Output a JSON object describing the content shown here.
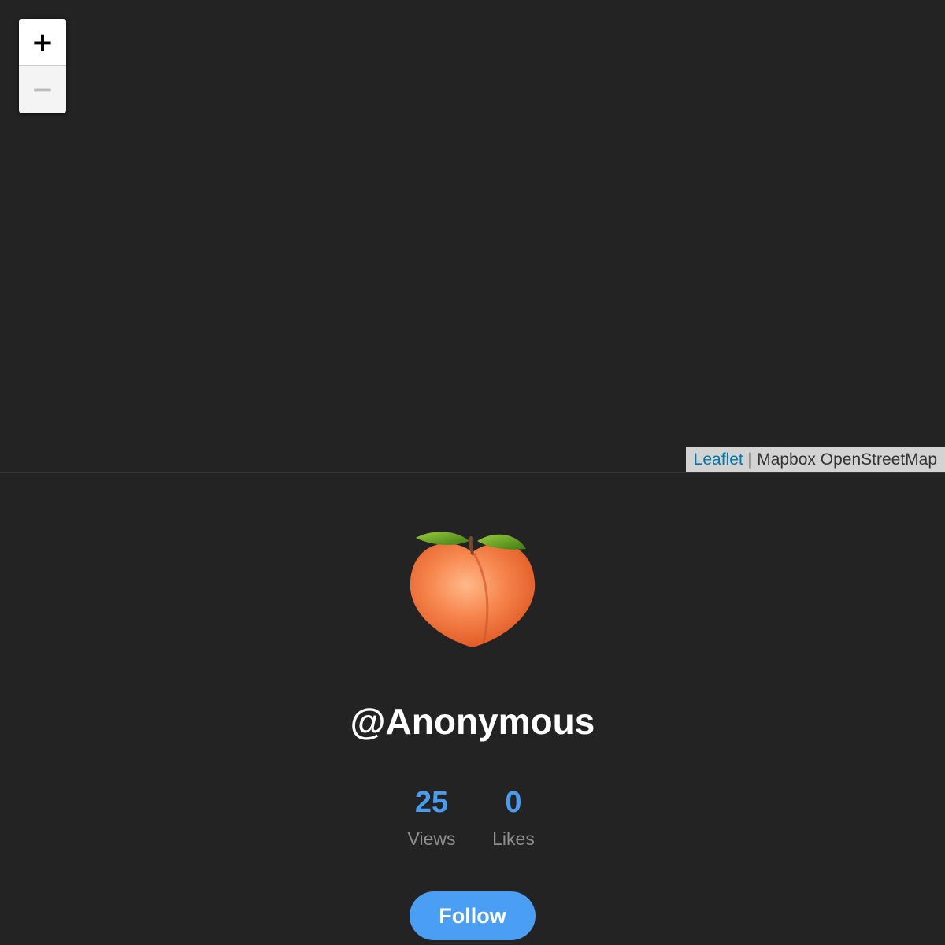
{
  "map": {
    "zoom_in_label": "+",
    "zoom_out_label": "−",
    "attribution": {
      "leaflet_link": "Leaflet",
      "separator": "|",
      "providers": "Mapbox OpenStreetMap"
    }
  },
  "profile": {
    "avatar_icon": "peach-emoji",
    "username": "@Anonymous",
    "stats": [
      {
        "value": "25",
        "label": "Views"
      },
      {
        "value": "0",
        "label": "Likes"
      }
    ],
    "follow_label": "Follow"
  },
  "colors": {
    "background": "#232323",
    "accent": "#4a9ff5",
    "stat_number": "#4a9cf0",
    "stat_label": "#8e8e8e",
    "link": "#0078A8"
  }
}
